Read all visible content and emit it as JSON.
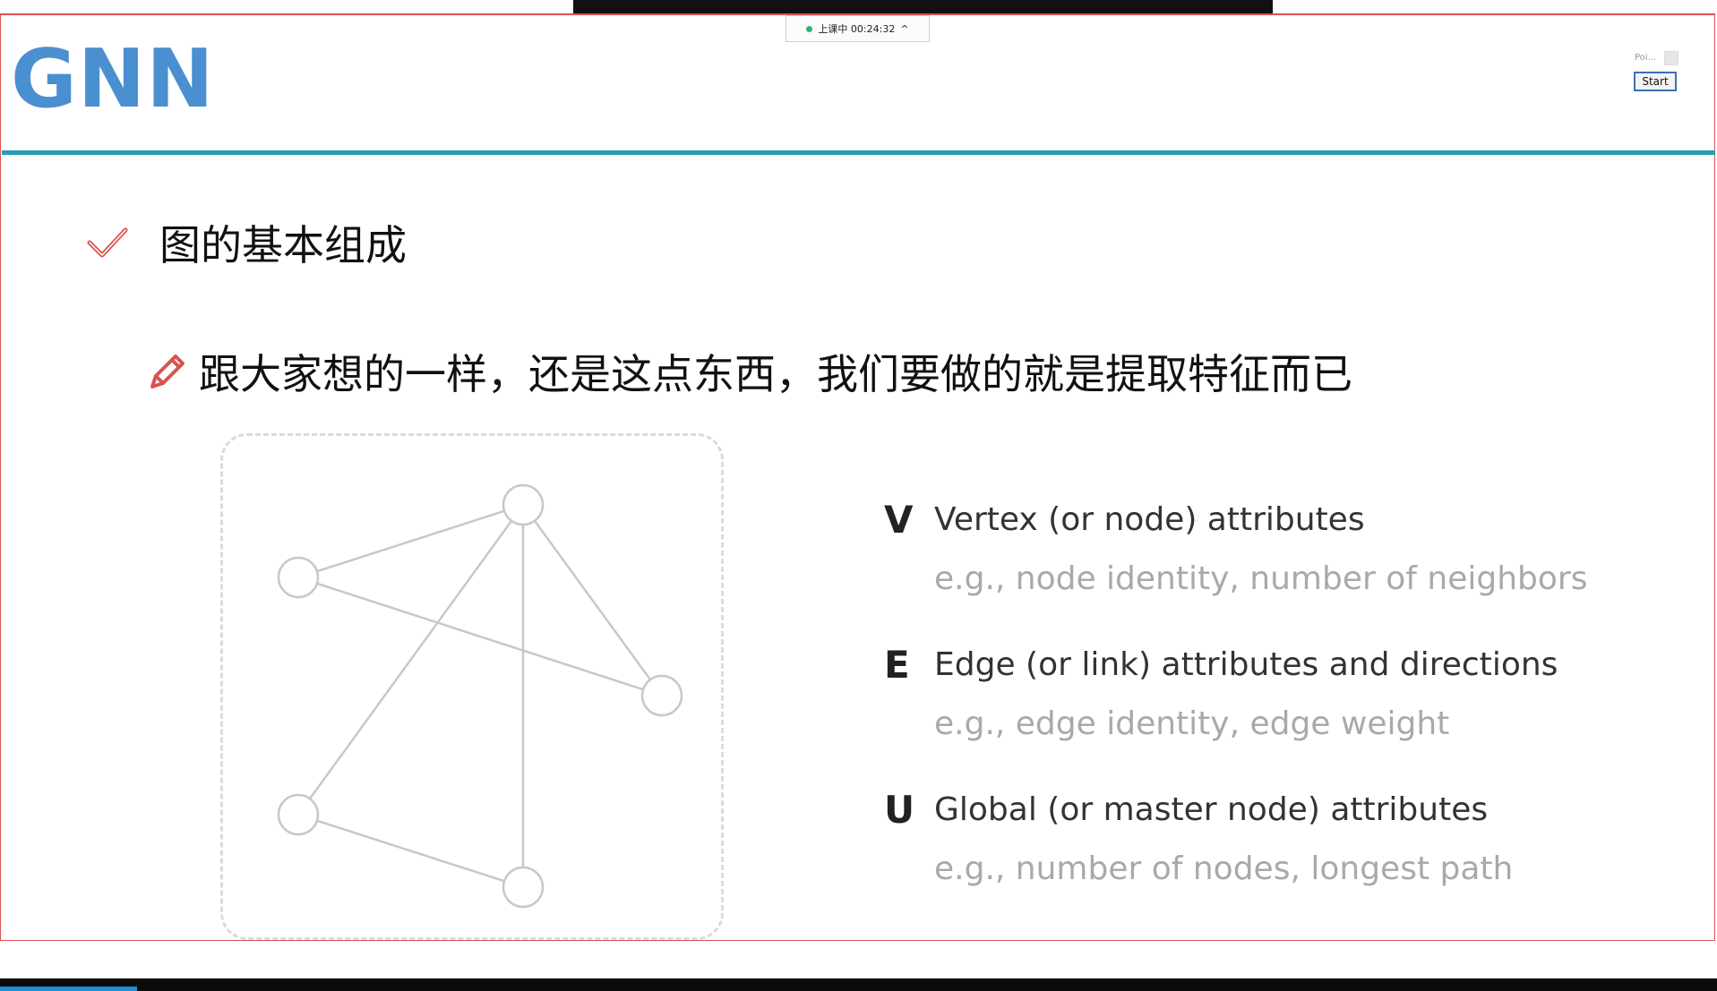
{
  "status": {
    "text": "上课中 00:24:32",
    "dot_color": "#2bb673",
    "chevron": "^"
  },
  "slide": {
    "title": "GNN",
    "title_color": "#4a8fcf",
    "rule_color": "#2a9bb7",
    "heading": "图的基本组成",
    "heading_icon": "check-icon",
    "subline": "跟大家想的一样，还是这点东西，我们要做的就是提取特征而已",
    "subline_icon": "pencil-icon",
    "attributes": [
      {
        "letter": "V",
        "label": "Vertex (or node) attributes",
        "example": "e.g., node identity, number of neighbors"
      },
      {
        "letter": "E",
        "label": "Edge (or link) attributes and directions",
        "example": "e.g., edge identity, edge weight"
      },
      {
        "letter": "U",
        "label": "Global (or master node) attributes",
        "example": "e.g., number of nodes, longest path"
      }
    ]
  },
  "mini_panel": {
    "label": "Poi...",
    "button": "Start"
  },
  "accent_red": "#d9534f",
  "progress_color": "#1a8fd1",
  "progress": 0.08
}
